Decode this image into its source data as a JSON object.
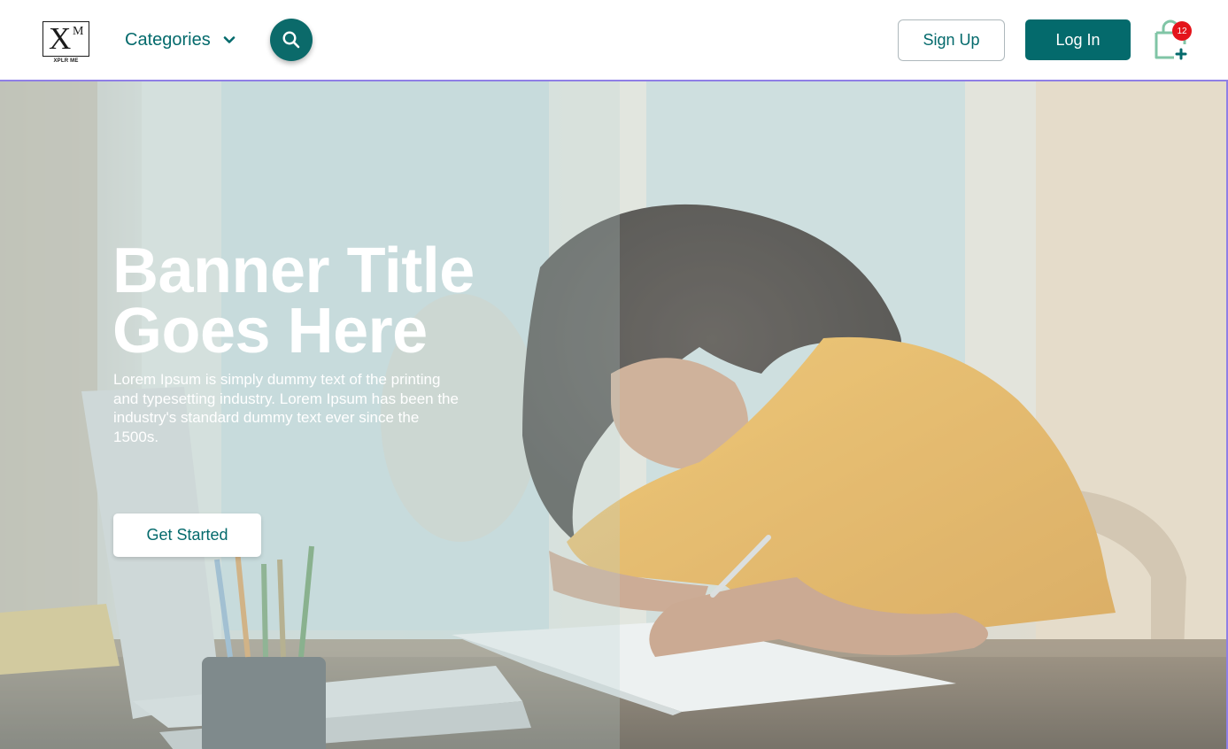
{
  "brand": {
    "logo_mark": "X",
    "logo_mark_small": "M",
    "logo_text": "XPLR ME"
  },
  "nav": {
    "categories_label": "Categories",
    "signup_label": "Sign Up",
    "login_label": "Log In",
    "cart_count": "12"
  },
  "hero": {
    "title_line1": "Banner Title",
    "title_line2": "Goes Here",
    "description": "Lorem Ipsum is simply dummy text of the printing and typesetting industry. Lorem Ipsum has been the industry's standard dummy text ever since the 1500s.",
    "cta_label": "Get Started"
  },
  "colors": {
    "brand_teal": "#046a6c",
    "badge_red": "#e4141b",
    "hero_border": "#8f7fe6"
  },
  "icons": [
    "chevron-down-icon",
    "search-icon",
    "shopping-bag-icon"
  ]
}
